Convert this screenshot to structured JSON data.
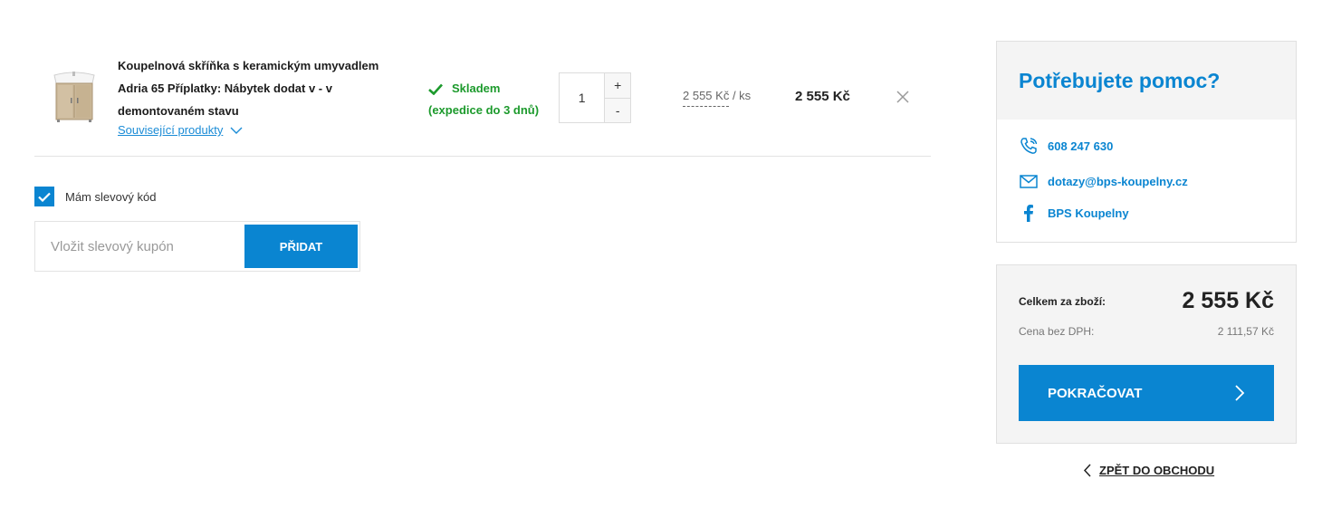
{
  "cart": {
    "item": {
      "name": "Koupelnová skříňka s keramickým umyvadlem Adria 65 Příplatky: Nábytek dodat v - v demontovaném stavu",
      "related_link": "Související produkty",
      "stock_status": "Skladem",
      "stock_note": "(expedice do 3 dnů)",
      "quantity": "1",
      "qty_plus": "+",
      "qty_minus": "-",
      "unit_price": "2 555 Kč",
      "unit_suffix": "/ ks",
      "line_total": "2 555 Kč"
    }
  },
  "discount": {
    "checkbox_label": "Mám slevový kód",
    "checked": true,
    "input_placeholder": "Vložit slevový kupón",
    "button_label": "PŘIDAT"
  },
  "help": {
    "title": "Potřebujete pomoc?",
    "phone": "608 247 630",
    "email": "dotazy@bps-koupelny.cz",
    "facebook": "BPS Koupelny"
  },
  "summary": {
    "total_label": "Celkem za zboží:",
    "total_value": "2 555 Kč",
    "net_label": "Cena bez DPH:",
    "net_value": "2 111,57 Kč",
    "continue_label": "POKRAČOVAT",
    "back_label": "ZPĚT DO OBCHODU"
  },
  "colors": {
    "accent": "#0a85d1",
    "stock_green": "#1c9a2c",
    "panel_bg": "#f4f4f4"
  },
  "icons": [
    "check-icon",
    "chevron-down-icon",
    "close-icon",
    "phone-icon",
    "mail-icon",
    "facebook-icon",
    "chevron-right-icon",
    "chevron-left-icon"
  ]
}
